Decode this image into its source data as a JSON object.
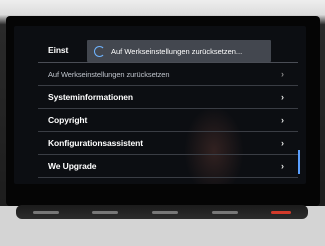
{
  "popup": {
    "text": "Auf Werkseinstellungen zurücksetzen..."
  },
  "header": {
    "label": "Einst"
  },
  "menu": {
    "items": [
      {
        "label": "Auf Werkseinstellungen zurücksetzen",
        "chevron": "›"
      },
      {
        "label": "Systeminformationen",
        "chevron": "›"
      },
      {
        "label": "Copyright",
        "chevron": "›"
      },
      {
        "label": "Konfigurationsassistent",
        "chevron": "›"
      },
      {
        "label": "We Upgrade",
        "chevron": "›"
      }
    ]
  },
  "icons": {
    "spinner": "loading-spinner-icon",
    "chevron": "chevron-right-icon"
  },
  "colors": {
    "accent": "#6fb4ff",
    "background": "#0c0e12",
    "text": "#ffffff",
    "divider": "#3a3d44"
  }
}
